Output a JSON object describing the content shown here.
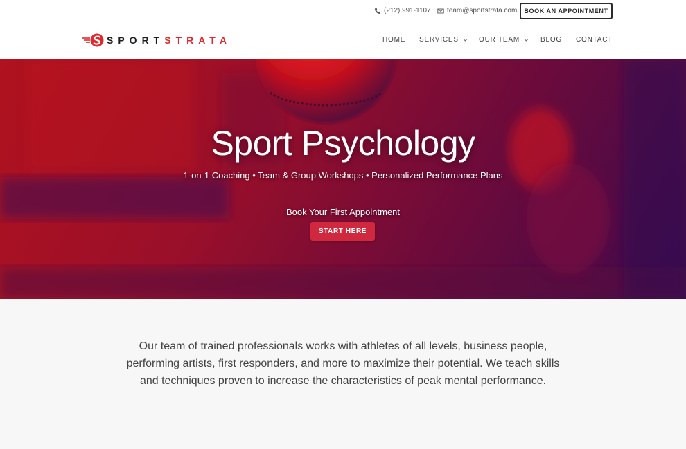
{
  "topbar": {
    "phone": "(212) 991-1107",
    "email": "team@sportstrata.com",
    "book_button": "BOOK AN APPOINTMENT"
  },
  "logo": {
    "word_part1": "SPORT",
    "word_part2": "STRATA"
  },
  "nav": {
    "items": [
      {
        "label": "HOME",
        "has_dropdown": false
      },
      {
        "label": "SERVICES",
        "has_dropdown": true
      },
      {
        "label": "OUR TEAM",
        "has_dropdown": true
      },
      {
        "label": "BLOG",
        "has_dropdown": false
      },
      {
        "label": "CONTACT",
        "has_dropdown": false
      }
    ]
  },
  "hero": {
    "title": "Sport Psychology",
    "subtitle": "1-on-1 Coaching • Team & Group Workshops • Personalized Performance Plans",
    "cta_label": "Book Your First Appointment",
    "cta_button": "START HERE"
  },
  "intro": {
    "text": "Our team of trained professionals works with athletes of all levels, business people, performing artists, first responders, and more to maximize their potential. We teach skills and techniques proven to increase the characteristics of peak mental performance."
  },
  "colors": {
    "brand_red": "#e0282e",
    "cta_red": "#d0293f",
    "dark": "#2b2b2b",
    "hero_gradient_start": "#b0121e",
    "hero_gradient_end": "#3b0a4d"
  },
  "icons": {
    "phone": "phone-icon",
    "email": "envelope-icon",
    "dropdown": "chevron-down-icon",
    "logo": "sportstrata-logo-icon"
  }
}
